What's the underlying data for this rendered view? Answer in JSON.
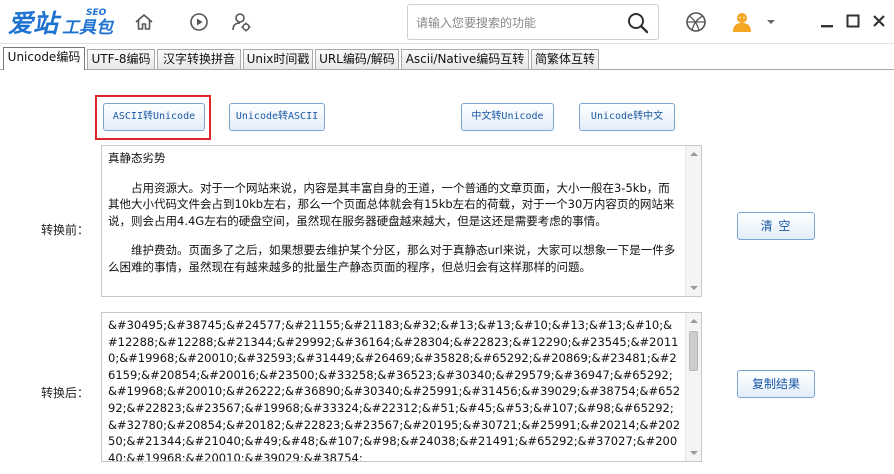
{
  "app": {
    "logo_text": "爱站工具包",
    "logo_main": "爱站",
    "logo_sub": "工具包",
    "logo_badge": "SEO"
  },
  "toolbar": {
    "icons": [
      "home-icon",
      "play-icon",
      "user-settings-icon"
    ],
    "search_placeholder": "请输入您要搜索的功能",
    "right_icons": [
      "basketball-icon",
      "user-avatar-icon",
      "dropdown-arrow-icon"
    ],
    "window_controls": [
      "minimize-icon",
      "maximize-icon",
      "close-icon"
    ]
  },
  "tabs": [
    {
      "label": "Unicode编码",
      "active": true
    },
    {
      "label": "UTF-8编码",
      "active": false
    },
    {
      "label": "汉字转换拼音",
      "active": false
    },
    {
      "label": "Unix时间戳",
      "active": false
    },
    {
      "label": "URL编码/解码",
      "active": false
    },
    {
      "label": "Ascii/Native编码互转",
      "active": false
    },
    {
      "label": "简繁体互转",
      "active": false
    }
  ],
  "buttons": {
    "ascii_to_unicode": "ASCII转Unicode",
    "unicode_to_ascii": "Unicode转ASCII",
    "chinese_to_unicode": "中文转Unicode",
    "unicode_to_chinese": "Unicode转中文",
    "clear": "清 空",
    "copy_result": "复制结果"
  },
  "labels": {
    "before": "转换前：",
    "after": "转换后："
  },
  "input_text": {
    "title": "真静态劣势",
    "para1": "占用资源大。对于一个网站来说，内容是其丰富自身的王道，一个普通的文章页面，大小一般在3-5kb，而其他大小代码文件会占到10kb左右，那么一个页面总体就会有15kb左右的荷载，对于一个30万内容页的网站来说，则会占用4.4G左右的硬盘空间，虽然现在服务器硬盘越来越大，但是这还是需要考虑的事情。",
    "para2": "维护费劲。页面多了之后，如果想要去维护某个分区，那么对于真静态url来说，大家可以想象一下是一件多么困难的事情，虽然现在有越来越多的批量生产静态页面的程序，但总归会有这样那样的问题。"
  },
  "output_text": "&#30495;&#38745;&#24577;&#21155;&#21183;&#32;&#13;&#13;&#10;&#13;&#13;&#10;&#12288;&#12288;&#21344;&#29992;&#36164;&#28304;&#22823;&#12290;&#23545;&#20110;&#19968;&#20010;&#32593;&#31449;&#26469;&#35828;&#65292;&#20869;&#23481;&#26159;&#20854;&#20016;&#23500;&#33258;&#36523;&#30340;&#29579;&#36947;&#65292;&#19968;&#20010;&#26222;&#36890;&#30340;&#25991;&#31456;&#39029;&#38754;&#65292;&#22823;&#23567;&#19968;&#33324;&#22312;&#51;&#45;&#53;&#107;&#98;&#65292;&#32780;&#20854;&#20182;&#22823;&#23567;&#20195;&#30721;&#25991;&#20214;&#20250;&#21344;&#21040;&#49;&#48;&#107;&#98;&#24038;&#21491;&#65292;&#37027;&#20040;&#19968;&#20010;&#39029;&#38754;"
}
